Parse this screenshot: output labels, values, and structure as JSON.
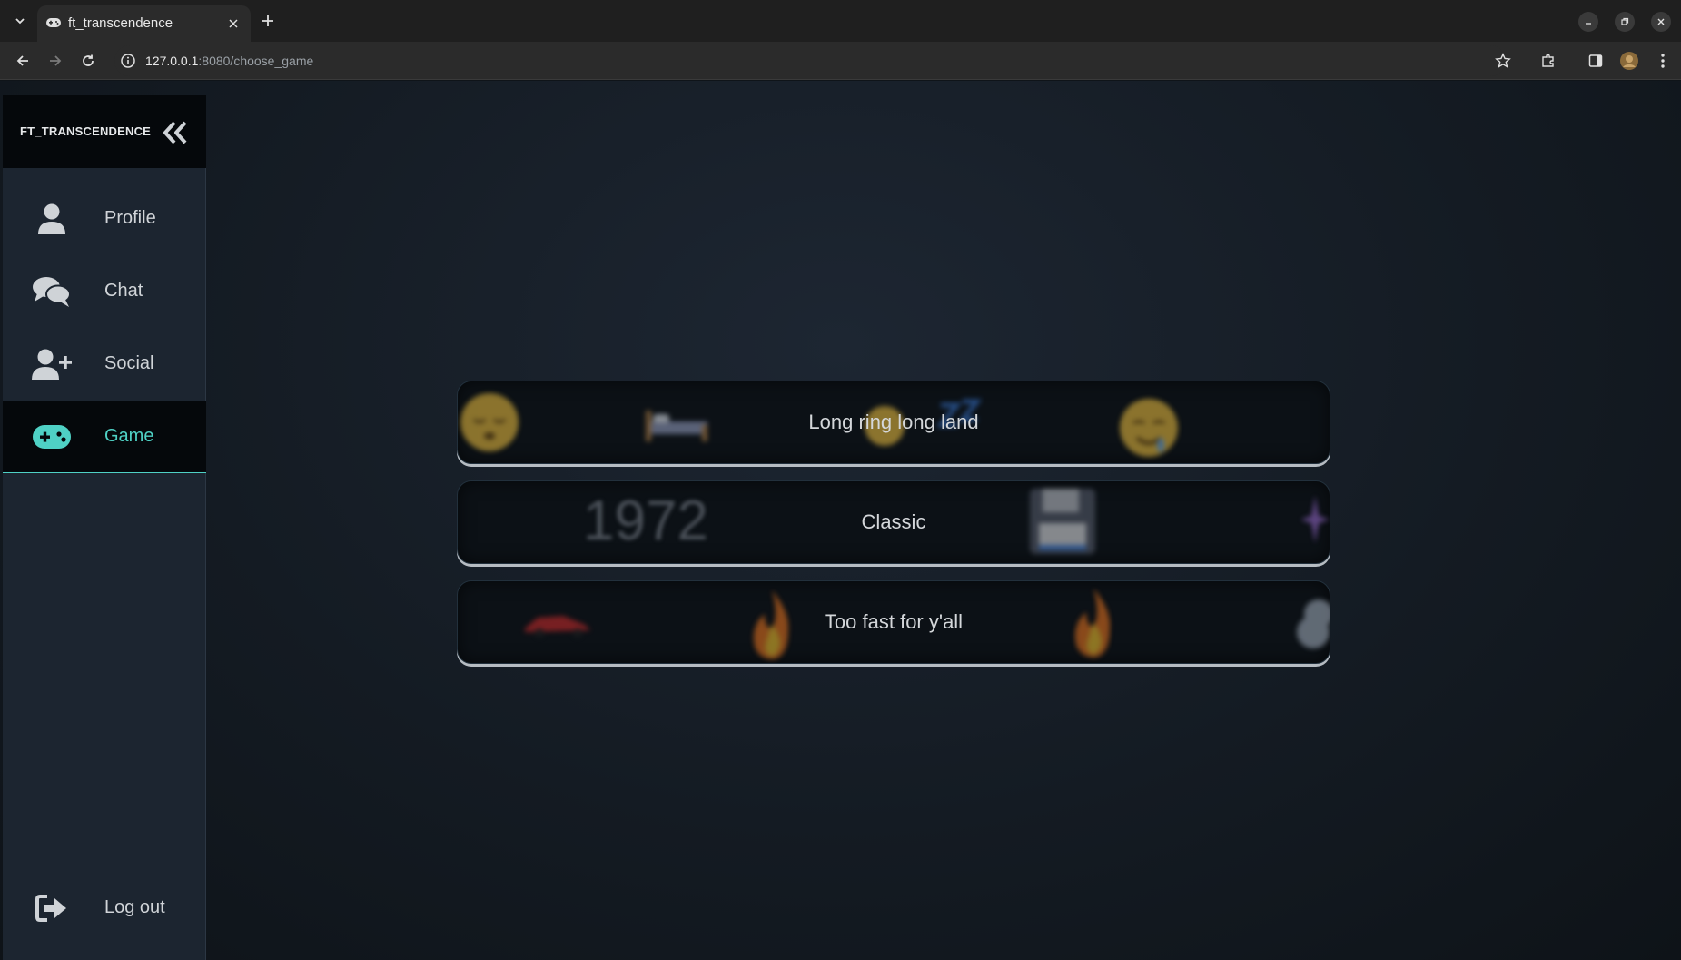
{
  "browser": {
    "tab_title": "ft_transcendence",
    "url_host": "127.0.0.1",
    "url_rest": ":8080/choose_game"
  },
  "sidebar": {
    "brand": "FT_TRANSCENDENCE",
    "items": [
      {
        "label": "Profile",
        "icon": "user-icon"
      },
      {
        "label": "Chat",
        "icon": "chat-bubbles-icon"
      },
      {
        "label": "Social",
        "icon": "add-user-icon"
      },
      {
        "label": "Game",
        "icon": "gamepad-icon",
        "active": true
      }
    ],
    "logout_label": "Log out"
  },
  "game_modes": [
    {
      "label": "Long ring long land",
      "decorations": [
        "sleeping-face",
        "bed",
        "zzz",
        "drooling-face"
      ]
    },
    {
      "label": "Classic",
      "decorations": [
        "1972",
        "floppy-disk"
      ]
    },
    {
      "label": "Too fast for y'all",
      "decorations": [
        "race-car",
        "fire",
        "fire",
        "dash"
      ]
    }
  ],
  "colors": {
    "accent": "#4fd1c5",
    "sidebar_bg": "#1c2530",
    "brand_bar_bg": "#05080b",
    "button_bg": "#0c1116"
  }
}
